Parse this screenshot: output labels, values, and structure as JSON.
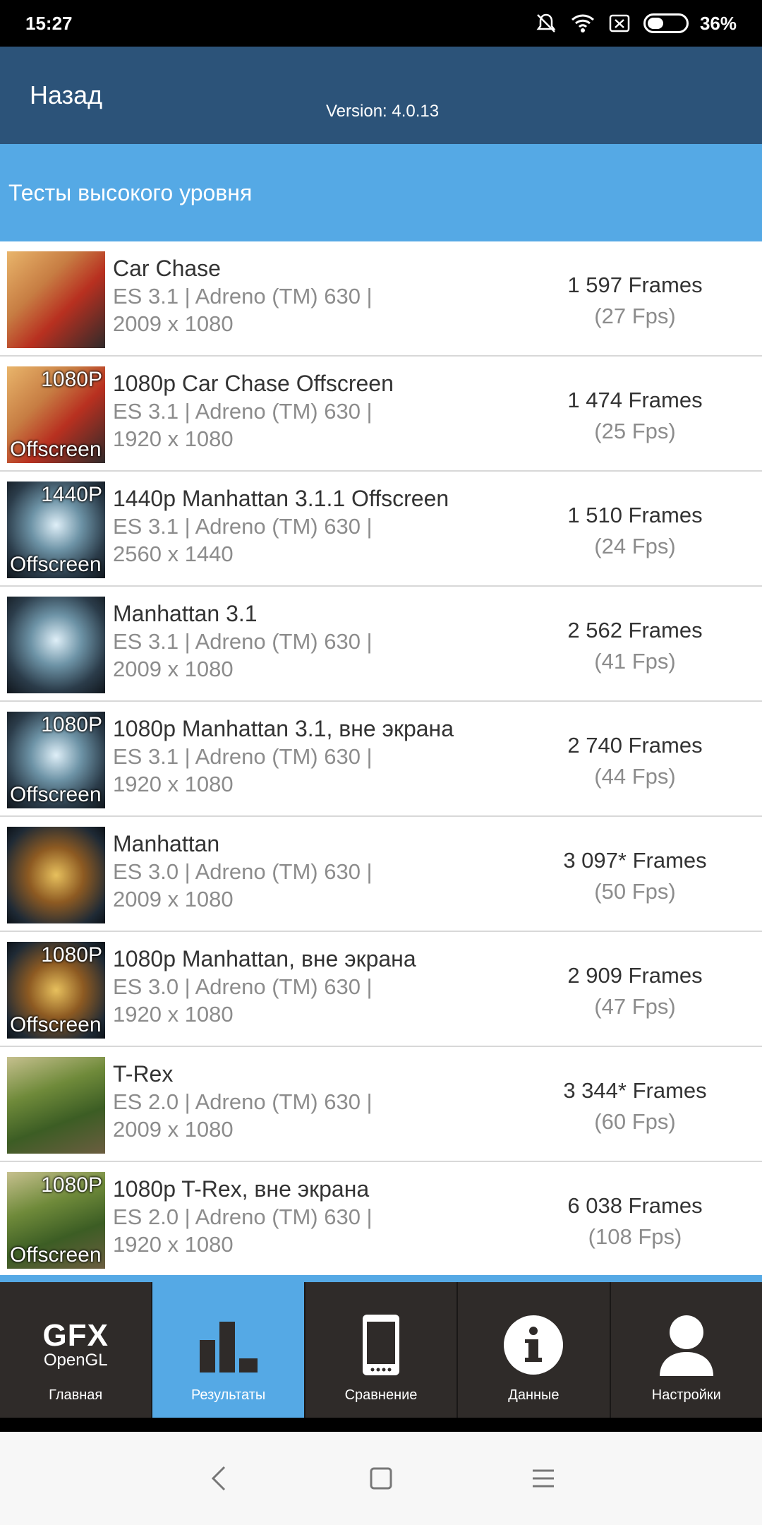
{
  "status_bar": {
    "time": "15:27",
    "battery": "36%",
    "icons": [
      "mute-vibrate-icon",
      "wifi-icon",
      "sim-error-icon",
      "battery-icon"
    ]
  },
  "header": {
    "back_label": "Назад",
    "version": "Version: 4.0.13"
  },
  "section_title": "Тесты высокого уровня",
  "tests": [
    {
      "name": "Car Chase",
      "api": "ES 3.1 | Adreno (TM) 630 |",
      "resolution": "2009 x 1080",
      "frames": "1 597 Frames",
      "fps": "(27 Fps)",
      "thumb": "car-chase",
      "badge_top": "",
      "badge_bottom": ""
    },
    {
      "name": "1080p Car Chase Offscreen",
      "api": "ES 3.1 | Adreno (TM) 630 |",
      "resolution": "1920 x 1080",
      "frames": "1 474 Frames",
      "fps": "(25 Fps)",
      "thumb": "car-chase",
      "badge_top": "1080P",
      "badge_bottom": "Offscreen"
    },
    {
      "name": "1440p Manhattan 3.1.1 Offscreen",
      "api": "ES 3.1 | Adreno (TM) 630 |",
      "resolution": "2560 x 1440",
      "frames": "1 510 Frames",
      "fps": "(24 Fps)",
      "thumb": "manhattan31",
      "badge_top": "1440P",
      "badge_bottom": "Offscreen"
    },
    {
      "name": "Manhattan 3.1",
      "api": "ES 3.1 | Adreno (TM) 630 |",
      "resolution": "2009 x 1080",
      "frames": "2 562 Frames",
      "fps": "(41 Fps)",
      "thumb": "manhattan31",
      "badge_top": "",
      "badge_bottom": ""
    },
    {
      "name": "1080p Manhattan 3.1, вне экрана",
      "api": "ES 3.1 | Adreno (TM) 630 |",
      "resolution": "1920 x 1080",
      "frames": "2 740 Frames",
      "fps": "(44 Fps)",
      "thumb": "manhattan31",
      "badge_top": "1080P",
      "badge_bottom": "Offscreen"
    },
    {
      "name": "Manhattan",
      "api": "ES 3.0 | Adreno (TM) 630 |",
      "resolution": "2009 x 1080",
      "frames": "3 097* Frames",
      "fps": "(50 Fps)",
      "thumb": "manhattan",
      "badge_top": "",
      "badge_bottom": ""
    },
    {
      "name": "1080p Manhattan, вне экрана",
      "api": "ES 3.0 | Adreno (TM) 630 |",
      "resolution": "1920 x 1080",
      "frames": "2 909 Frames",
      "fps": "(47 Fps)",
      "thumb": "manhattan",
      "badge_top": "1080P",
      "badge_bottom": "Offscreen"
    },
    {
      "name": "T-Rex",
      "api": "ES 2.0 | Adreno (TM) 630 |",
      "resolution": "2009 x 1080",
      "frames": "3 344* Frames",
      "fps": "(60 Fps)",
      "thumb": "trex",
      "badge_top": "",
      "badge_bottom": ""
    },
    {
      "name": "1080p T-Rex, вне экрана",
      "api": "ES 2.0 | Adreno (TM) 630 |",
      "resolution": "1920 x 1080",
      "frames": "6 038 Frames",
      "fps": "(108 Fps)",
      "thumb": "trex",
      "badge_top": "1080P",
      "badge_bottom": "Offscreen"
    }
  ],
  "bottom_nav": {
    "logo_gfx": "GFX",
    "logo_opengl": "OpenGL",
    "items": [
      {
        "label": "Главная",
        "icon": "gfx-logo-icon",
        "active": false
      },
      {
        "label": "Результаты",
        "icon": "bar-chart-icon",
        "active": true
      },
      {
        "label": "Сравнение",
        "icon": "phone-icon",
        "active": false
      },
      {
        "label": "Данные",
        "icon": "info-icon",
        "active": false
      },
      {
        "label": "Настройки",
        "icon": "user-icon",
        "active": false
      }
    ]
  },
  "system_nav": {
    "icons": [
      "back-icon",
      "home-icon",
      "menu-icon"
    ]
  },
  "colors": {
    "header_bg": "#2c5379",
    "section_bg": "#55a9e5",
    "nav_bg": "#2f2b29",
    "nav_active": "#55a9e5"
  }
}
